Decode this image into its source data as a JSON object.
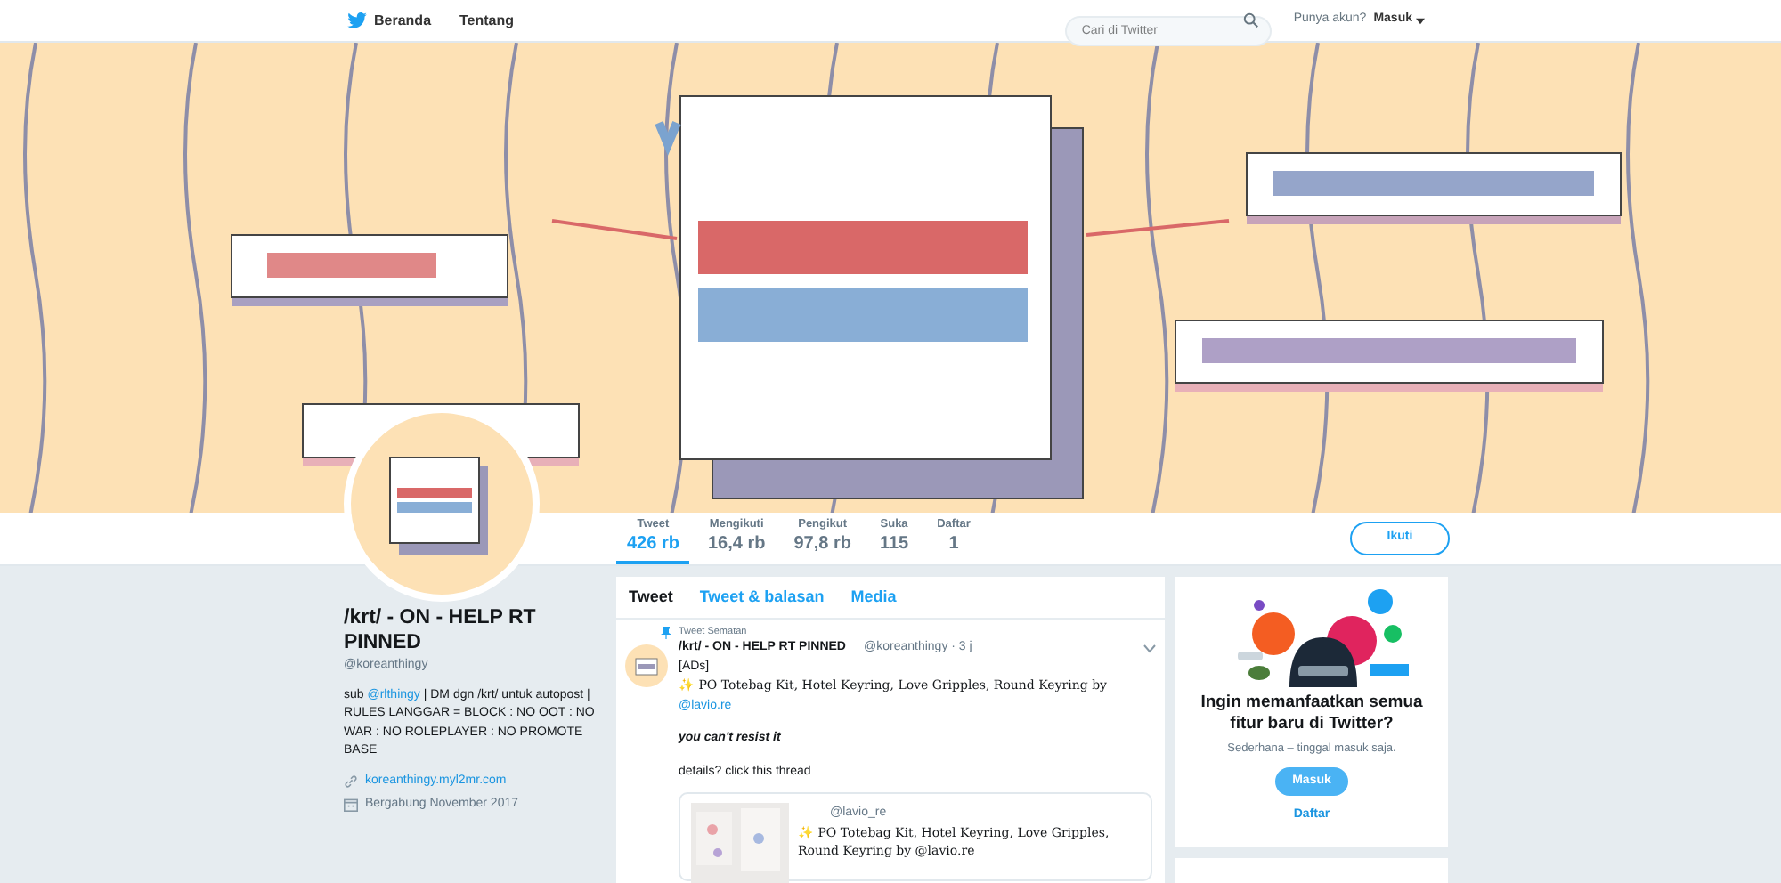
{
  "top_nav": {
    "links": [
      {
        "label": "Beranda",
        "kind": "home"
      },
      {
        "label": "Tentang",
        "kind": "plain"
      }
    ],
    "search": {
      "placeholder": "Cari di Twitter"
    },
    "account_prompt": "Punya akun?",
    "login_menu": "Masuk"
  },
  "stats": [
    {
      "label": "Tweet",
      "value": "426 rb",
      "selected": true
    },
    {
      "label": "Mengikuti",
      "value": "16,4 rb",
      "selected": false
    },
    {
      "label": "Pengikut",
      "value": "97,8 rb",
      "selected": false
    },
    {
      "label": "Suka",
      "value": "115",
      "selected": false
    },
    {
      "label": "Daftar",
      "value": "1",
      "selected": false
    }
  ],
  "follow_button": "Ikuti",
  "profile": {
    "name": "/krt/ - ON - HELP RT PINNED",
    "handle": "@koreanthingy",
    "bio": [
      {
        "kind": "text",
        "text": "sub "
      },
      {
        "kind": "link",
        "text": "@rlthingy"
      },
      {
        "kind": "text",
        "text": " | DM dgn /krt/ untuk autopost | RULES LANGGAR = BLOCK : NO OOT : NO WAR : NO ROLEPLAYER : NO PROMOTE BASE"
      }
    ],
    "website": "koreanthingy.myl2mr.com",
    "joined": "Bergabung November 2017"
  },
  "timeline_tabs": [
    {
      "label": "Tweet",
      "selected": true
    },
    {
      "label": "Tweet & balasan",
      "selected": false
    },
    {
      "label": "Media",
      "selected": false
    }
  ],
  "pinned_tweet": {
    "context": "Tweet Sematan",
    "author": "/krt/ - ON - HELP RT PINNED",
    "handle_time": "@koreanthingy · 3 j",
    "lines": [
      {
        "kind": "plain",
        "parts": [
          {
            "kind": "text",
            "text": "[ADs]"
          }
        ]
      },
      {
        "kind": "fancy",
        "parts": [
          {
            "kind": "text",
            "text": "✨ PO Totebag Kit, Hotel Keyring, Love Gripples, Round Keyring by "
          },
          {
            "kind": "link",
            "text": "@lavio.re"
          }
        ]
      },
      {
        "kind": "emphasis",
        "parts": [
          {
            "kind": "text",
            "text": "you can't resist it"
          }
        ]
      },
      {
        "kind": "plain",
        "parts": [
          {
            "kind": "text",
            "text": "details? click this thread"
          }
        ]
      }
    ],
    "quote": {
      "handle": "@lavio_re",
      "text": "✨ PO Totebag Kit, Hotel Keyring, Love Gripples, Round Keyring by @lavio.re"
    }
  },
  "signup_card": {
    "title": "Ingin memanfaatkan semua fitur baru di Twitter?",
    "subtitle": "Sederhana – tinggal masuk saja.",
    "login_button": "Masuk",
    "signup_link": "Daftar"
  }
}
